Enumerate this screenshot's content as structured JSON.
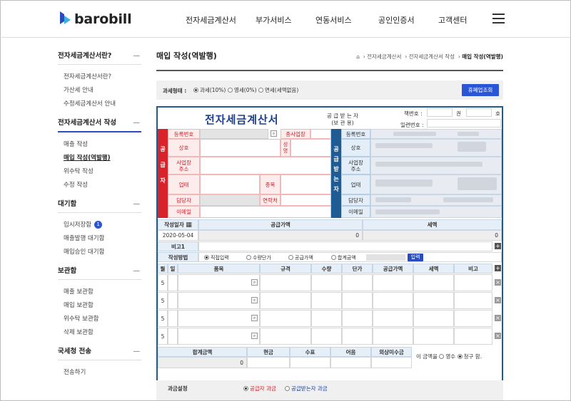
{
  "logo": {
    "text": "barobill"
  },
  "gnb": [
    "전자세금계산서",
    "부가서비스",
    "연동서비스",
    "공인인증서",
    "고객센터"
  ],
  "lnb": {
    "sections": [
      {
        "title": "전자세금계산서란?",
        "items": [
          "전자세금계산서란?",
          "가산세 안내",
          "수정세금계산서 안내"
        ]
      },
      {
        "title": "전자세금계산서 작성",
        "items": [
          "매출 작성",
          "매입 작성(역발행)",
          "위수탁 작성",
          "수정 작성"
        ]
      },
      {
        "title": "대기함",
        "items": [
          "임시저장함",
          "매출발행 대기함",
          "매입승인 대기함"
        ],
        "badge": "1"
      },
      {
        "title": "보관함",
        "items": [
          "매출 보관함",
          "매입 보관함",
          "위수탁 보관함",
          "삭제 보관함"
        ]
      },
      {
        "title": "국세청 전송",
        "items": [
          "전송하기"
        ]
      }
    ],
    "dash": "—"
  },
  "page": {
    "title": "매입 작성(역발행)",
    "breadcrumb": [
      "전자세금계산서",
      "전자세금계산서 작성",
      "매입 작성(역발행)"
    ]
  },
  "taxbar": {
    "label": "과세형태 :",
    "options": [
      "과세(10%)",
      "영세(0%)",
      "면세(세액없음)"
    ],
    "selected": 0,
    "button": "휴폐업조회"
  },
  "invoice": {
    "title": "전자세금계산서",
    "receiver_note_1": "공 급 받 는 자",
    "receiver_note_2": "(보 관 용)",
    "book_no_label": "책번호 :",
    "book_kwon": "권",
    "book_ho": "호",
    "serial_label": "일련번호 :",
    "supplier_side": [
      "공",
      "급",
      "자"
    ],
    "receiver_side": [
      "공",
      "급",
      "받",
      "는",
      "자"
    ],
    "supplier_labels": {
      "reg_no": "등록번호",
      "branch": "종사업장",
      "name": "상호",
      "ceo": "성명",
      "address": "사업장\n주소",
      "biz_type": "업태",
      "biz_item": "종목",
      "manager": "담당자",
      "contact": "연락처",
      "email": "이메일"
    },
    "receiver_labels": {
      "reg_no": "등록번호",
      "name": "상호",
      "address": "사업장\n주소",
      "biz_type": "업태",
      "manager": "담당자",
      "email": "이메일"
    },
    "summary": {
      "date_label": "작성일자",
      "supply_label": "공급가액",
      "tax_label": "세액",
      "date": "2020-05-04",
      "supply": "0",
      "tax": "0",
      "note_label": "비고1",
      "method_label": "작성방법",
      "methods": [
        "직접입력",
        "수량단가",
        "공급가액",
        "합계금액"
      ],
      "method_selected": 0,
      "input_button": "입력"
    },
    "items": {
      "headers": [
        "월",
        "일",
        "품목",
        "규격",
        "수량",
        "단가",
        "공급가액",
        "세액",
        "비고"
      ],
      "rows": [
        {
          "month": "5"
        },
        {
          "month": "5"
        },
        {
          "month": "5"
        },
        {
          "month": "5"
        }
      ]
    },
    "totals": {
      "headers": [
        "합계금액",
        "현금",
        "수표",
        "어음",
        "외상미수금"
      ],
      "total": "0",
      "tail_prefix": "이 금액을",
      "receipt": "영수",
      "claim": "청구",
      "tail_suffix": "함.",
      "selected": "청구"
    }
  },
  "fee": {
    "label": "과금설정",
    "options": [
      "공급자 과금",
      "공급받는자 과금"
    ],
    "selected": 0
  }
}
